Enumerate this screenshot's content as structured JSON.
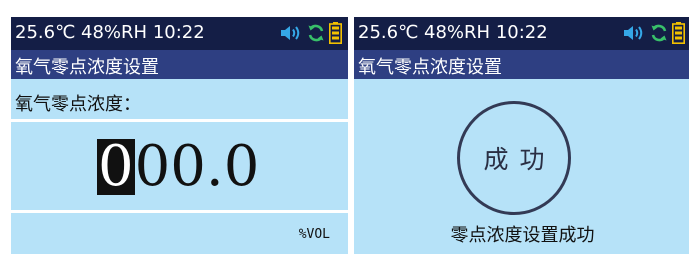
{
  "colors": {
    "status_bar_bg": "#141e46",
    "title_bar_bg": "#2e3f82",
    "screen_bg": "#b6e2f8",
    "divider": "#ffffff",
    "volume_icon": "#35a8e8",
    "sync_icon": "#38c06a",
    "battery_icon": "#f2c100"
  },
  "left_screen": {
    "status": {
      "temperature": "25.6℃",
      "humidity": "48%RH",
      "time": "10:22"
    },
    "icons": [
      "volume-icon",
      "sync-icon",
      "battery-icon"
    ],
    "title": "氧气零点浓度设置",
    "label": "氧气零点浓度：",
    "value": {
      "cursor_digit": "0",
      "rest": "00.0"
    },
    "unit": "%VOL"
  },
  "right_screen": {
    "status": {
      "temperature": "25.6℃",
      "humidity": "48%RH",
      "time": "10:22"
    },
    "icons": [
      "volume-icon",
      "sync-icon",
      "battery-icon"
    ],
    "title": "氧气零点浓度设置",
    "circle_text": "成功",
    "message": "零点浓度设置成功"
  }
}
